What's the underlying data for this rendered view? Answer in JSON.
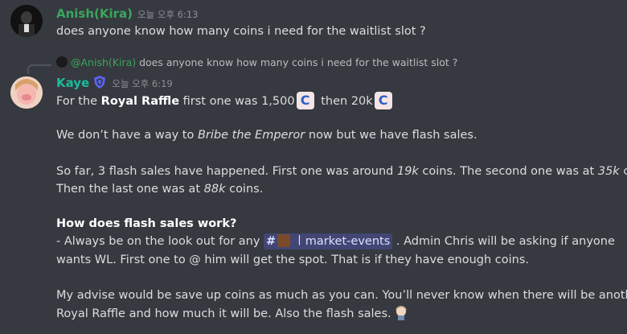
{
  "message1": {
    "author": "Anish(Kira)",
    "author_color": "#3ba55d",
    "timestamp": "오늘 오후 6:13",
    "content": "does anyone know how many coins i need for the waitlist slot ?"
  },
  "reply_preview": {
    "mention": "@Anish(Kira)",
    "content": "does anyone know how many coins i need for the waitlist slot ?"
  },
  "message2": {
    "author": "Kaye",
    "author_color": "#1abc9c",
    "timestamp": "오늘 오후 6:19",
    "line1": {
      "prefix": "For the ",
      "bold": "Royal Raffle",
      "mid": " first one was 1,500",
      "coin_glyph": "C",
      "mid2": " then 20k"
    },
    "line2": {
      "prefix": "We don’t have a way to ",
      "italic": "Bribe the Emperor",
      "suffix": " now but we have flash sales."
    },
    "line3": {
      "prefix": "So far, 3 flash sales have happened. First one was around ",
      "italic1": "19k",
      "mid": " coins. The second one was at ",
      "italic2": "35k",
      "suffix": " coins."
    },
    "line4": {
      "prefix": "Then the last one was at ",
      "italic": "88k",
      "suffix": " coins."
    },
    "line5_bold": "How does flash sales work?",
    "line6": {
      "prefix": "- Always be on the look out for any ",
      "channel_hash": "#",
      "channel_name": "〡market-events",
      "suffix": " . Admin Chris will be asking if anyone"
    },
    "line7": "wants WL. First one to @ him will get the spot. That is if they have enough coins.",
    "line8": "My advise would be save up coins as much as you can. You’ll never know when there will be another",
    "line9": "Royal Raffle and how much it will be. Also the flash sales."
  }
}
